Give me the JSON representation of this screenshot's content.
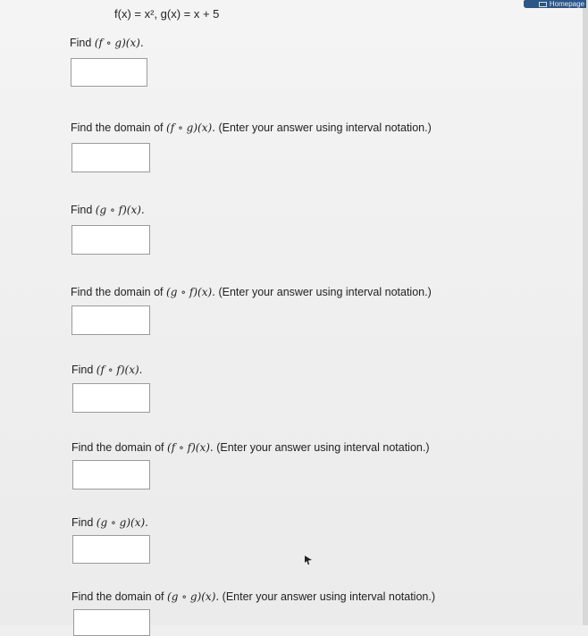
{
  "header": {
    "homepage_label": "Homepage",
    "f_def": "f(x) = x², ",
    "g_def": "g(x) = x + 5"
  },
  "questions": [
    {
      "id": "fog",
      "prefix": "Find ",
      "expr": "(f ∘ g)(x).",
      "suffix": ""
    },
    {
      "id": "fog-domain",
      "prefix": "Find the domain of ",
      "expr": "(f ∘ g)(x).",
      "suffix": " (Enter your answer using interval notation.)"
    },
    {
      "id": "gof",
      "prefix": "Find ",
      "expr": "(g ∘ f)(x).",
      "suffix": ""
    },
    {
      "id": "gof-domain",
      "prefix": "Find the domain of ",
      "expr": "(g ∘ f)(x).",
      "suffix": " (Enter your answer using interval notation.)"
    },
    {
      "id": "fof",
      "prefix": "Find ",
      "expr": "(f ∘ f)(x).",
      "suffix": ""
    },
    {
      "id": "fof-domain",
      "prefix": "Find the domain of ",
      "expr": "(f ∘ f)(x).",
      "suffix": " (Enter your answer using interval notation.)"
    },
    {
      "id": "gog",
      "prefix": "Find ",
      "expr": "(g ∘ g)(x).",
      "suffix": ""
    },
    {
      "id": "gog-domain",
      "prefix": "Find the domain of ",
      "expr": "(g ∘ g)(x).",
      "suffix": " (Enter your answer using interval notation.)"
    }
  ],
  "answers": [
    "",
    "",
    "",
    "",
    "",
    "",
    "",
    ""
  ],
  "colors": {
    "tab": "#2d5586",
    "page": "#f0f0f0",
    "box_border": "#9a9a9a"
  },
  "icons": {
    "cursor": "mouse-pointer-icon",
    "tab": "homepage-icon"
  }
}
